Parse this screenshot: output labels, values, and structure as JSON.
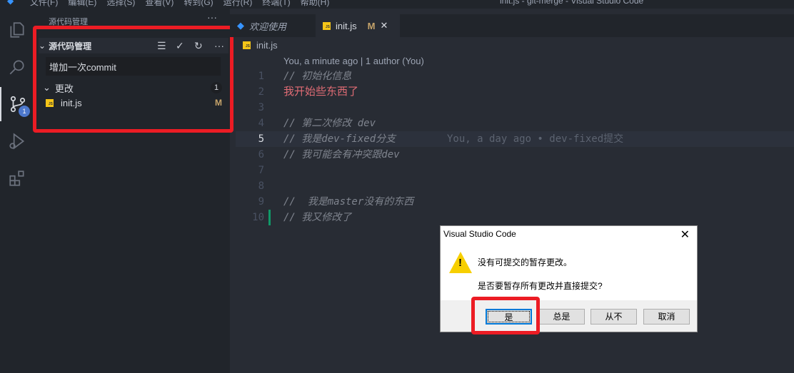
{
  "window": {
    "title": "init.js - git-merge - Visual Studio Code",
    "menu": [
      "文件(F)",
      "编辑(E)",
      "选择(S)",
      "查看(V)",
      "转到(G)",
      "运行(R)",
      "终端(T)",
      "帮助(H)"
    ]
  },
  "activity_bar": {
    "scm_badge": "1"
  },
  "sidebar": {
    "title": "源代码管理",
    "section": "源代码管理",
    "commit_message": "增加一次commit",
    "changes_label": "更改",
    "changes_count": "1",
    "files": [
      {
        "name": "init.js",
        "status": "M"
      }
    ]
  },
  "tabs": [
    {
      "label": "欢迎使用"
    },
    {
      "label": "init.js",
      "status": "M"
    }
  ],
  "breadcrumb": "init.js",
  "editor": {
    "codelens": "You, a minute ago | 1 author (You)",
    "lines": [
      {
        "n": "1",
        "text": "// 初始化信息"
      },
      {
        "n": "2",
        "text": "我开始些东西了"
      },
      {
        "n": "3",
        "text": ""
      },
      {
        "n": "4",
        "text": "// 第二次修改 dev"
      },
      {
        "n": "5",
        "text": "// 我是dev-fixed分支",
        "blame": "You, a day ago • dev-fixed提交"
      },
      {
        "n": "6",
        "text": "// 我可能会有冲突跟dev"
      },
      {
        "n": "7",
        "text": ""
      },
      {
        "n": "8",
        "text": ""
      },
      {
        "n": "9",
        "text": "//  我是master没有的东西"
      },
      {
        "n": "10",
        "text": "// 我又修改了"
      }
    ]
  },
  "dialog": {
    "title": "Visual Studio Code",
    "message": "没有可提交的暂存更改。",
    "question": "是否要暂存所有更改并直接提交?",
    "buttons": [
      "是",
      "总是",
      "从不",
      "取消"
    ]
  },
  "highlight_color": "#ec1c24"
}
